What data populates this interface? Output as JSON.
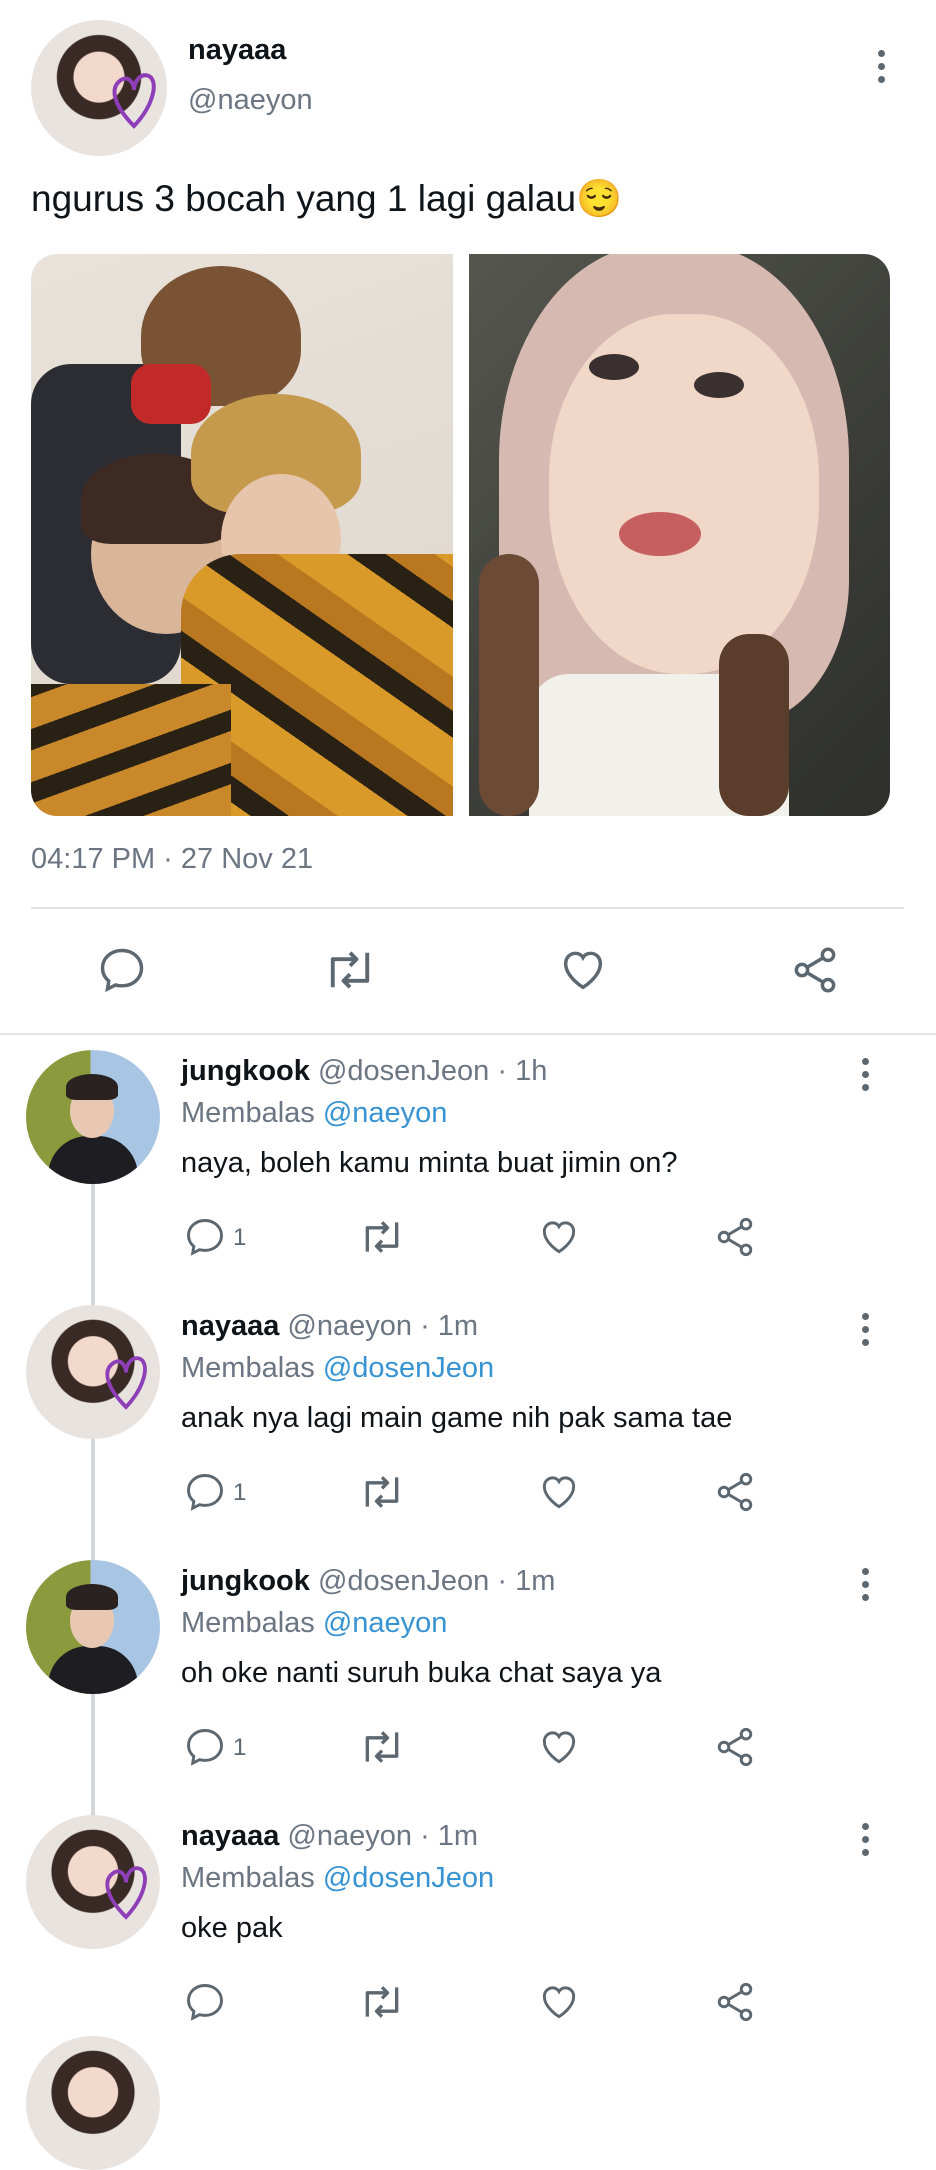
{
  "post": {
    "display_name": "nayaaa",
    "handle": "@naeyon",
    "text": "ngurus 3 bocah yang 1 lagi galau",
    "emoji": "😌",
    "timestamp": "04:17 PM · 27 Nov 21",
    "images": [
      "group-photo",
      "selfie-photo"
    ],
    "actions": [
      "reply-icon",
      "retweet-icon",
      "like-icon",
      "share-icon"
    ]
  },
  "replies": [
    {
      "name": "jungkook",
      "handle": "@dosenJeon",
      "time": "· 1h",
      "replying_label": "Membalas",
      "replying_to": "@naeyon",
      "text": "naya, boleh kamu minta buat jimin on?",
      "reply_count": "1"
    },
    {
      "name": "nayaaa",
      "handle": "@naeyon",
      "time": "· 1m",
      "replying_label": "Membalas",
      "replying_to": "@dosenJeon",
      "text": "anak nya lagi main game nih pak sama tae",
      "reply_count": "1"
    },
    {
      "name": "jungkook",
      "handle": "@dosenJeon",
      "time": "· 1m",
      "replying_label": "Membalas",
      "replying_to": "@naeyon",
      "text": "oh oke nanti suruh buka chat saya ya",
      "reply_count": "1"
    },
    {
      "name": "nayaaa",
      "handle": "@naeyon",
      "time": "· 1m",
      "replying_label": "Membalas",
      "replying_to": "@dosenJeon",
      "text": "oke pak",
      "reply_count": ""
    }
  ],
  "colors": {
    "link": "#3793d1",
    "muted": "#6b7682",
    "divider": "#e1e5e8"
  }
}
